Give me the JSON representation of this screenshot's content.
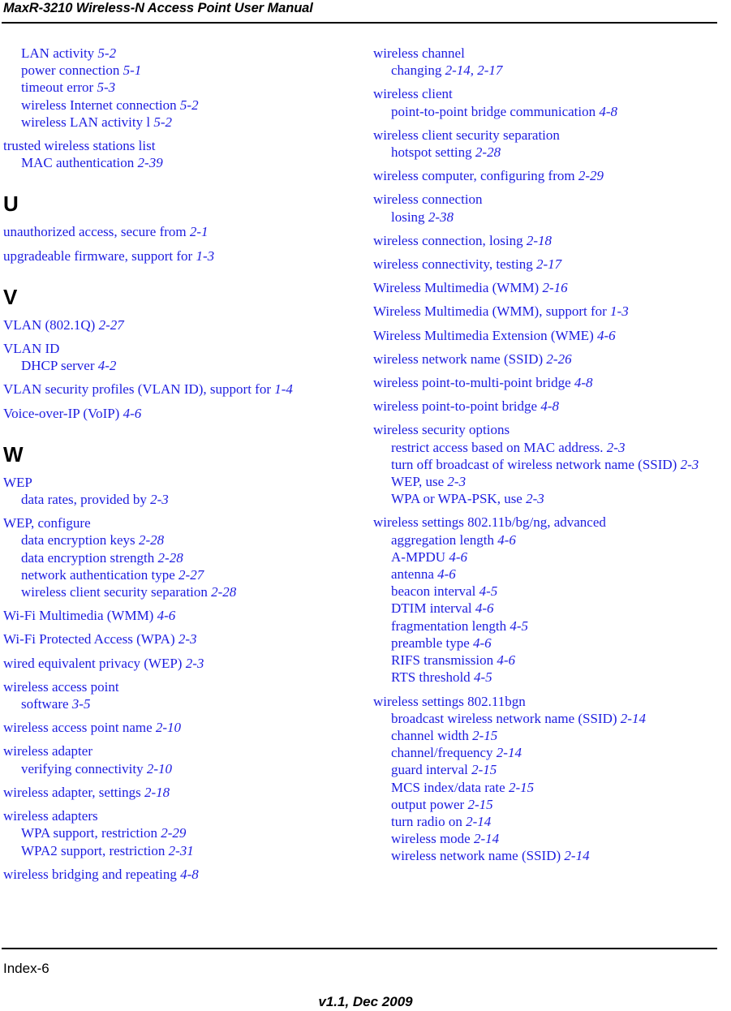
{
  "header": {
    "title": "MaxR-3210 Wireless-N Access Point User Manual"
  },
  "footer": {
    "page_label": "Index-6",
    "version": "v1.1, Dec 2009"
  },
  "colors": {
    "entry_text": "#1D1DE0",
    "heading_text": "#000000",
    "rule": "#000000",
    "background": "#FFFFFF"
  },
  "index": {
    "columns": [
      {
        "id": "left",
        "blocks": [
          {
            "type": "group",
            "entries": [
              {
                "level": 1,
                "text": "LAN activity ",
                "locator": "5-2"
              },
              {
                "level": 1,
                "text": "power connection ",
                "locator": "5-1"
              },
              {
                "level": 1,
                "text": "timeout error ",
                "locator": "5-3"
              },
              {
                "level": 1,
                "text": "wireless Internet connection ",
                "locator": "5-2"
              },
              {
                "level": 1,
                "text": "wireless LAN activity l ",
                "locator": "5-2"
              }
            ]
          },
          {
            "type": "group",
            "entries": [
              {
                "level": 0,
                "text": "trusted wireless stations list",
                "locator": ""
              },
              {
                "level": 1,
                "text": "MAC authentication ",
                "locator": "2-39"
              }
            ]
          },
          {
            "type": "section",
            "letter": "U",
            "gap_before": true,
            "blocks": [
              {
                "type": "group",
                "entries": [
                  {
                    "level": 0,
                    "text": "unauthorized access, secure from ",
                    "locator": "2-1"
                  }
                ]
              },
              {
                "type": "group",
                "entries": [
                  {
                    "level": 0,
                    "text": "upgradeable firmware, support for ",
                    "locator": "1-3"
                  }
                ]
              }
            ]
          },
          {
            "type": "section",
            "letter": "V",
            "gap_before": true,
            "blocks": [
              {
                "type": "group",
                "entries": [
                  {
                    "level": 0,
                    "text": "VLAN (802.1Q) ",
                    "locator": "2-27"
                  }
                ]
              },
              {
                "type": "group",
                "entries": [
                  {
                    "level": 0,
                    "text": "VLAN ID",
                    "locator": ""
                  },
                  {
                    "level": 1,
                    "text": "DHCP server ",
                    "locator": "4-2"
                  }
                ]
              },
              {
                "type": "group",
                "entries": [
                  {
                    "level": 0,
                    "text": "VLAN security profiles (VLAN ID), support for ",
                    "locator": "1-4"
                  }
                ]
              },
              {
                "type": "group",
                "entries": [
                  {
                    "level": 0,
                    "text": "Voice-over-IP (VoIP) ",
                    "locator": "4-6"
                  }
                ]
              }
            ]
          },
          {
            "type": "section",
            "letter": "W",
            "gap_before": true,
            "blocks": [
              {
                "type": "group",
                "entries": [
                  {
                    "level": 0,
                    "text": "WEP",
                    "locator": ""
                  },
                  {
                    "level": 1,
                    "text": "data rates, provided by ",
                    "locator": "2-3"
                  }
                ]
              },
              {
                "type": "group",
                "entries": [
                  {
                    "level": 0,
                    "text": "WEP, configure",
                    "locator": ""
                  },
                  {
                    "level": 1,
                    "text": "data encryption keys ",
                    "locator": "2-28"
                  },
                  {
                    "level": 1,
                    "text": "data encryption strength ",
                    "locator": "2-28"
                  },
                  {
                    "level": 1,
                    "text": "network authentication type ",
                    "locator": "2-27"
                  },
                  {
                    "level": 1,
                    "text": "wireless client security separation ",
                    "locator": "2-28"
                  }
                ]
              },
              {
                "type": "group",
                "entries": [
                  {
                    "level": 0,
                    "text": "Wi-Fi Multimedia (WMM) ",
                    "locator": "4-6"
                  }
                ]
              },
              {
                "type": "group",
                "entries": [
                  {
                    "level": 0,
                    "text": "Wi-Fi Protected Access (WPA) ",
                    "locator": "2-3"
                  }
                ]
              },
              {
                "type": "group",
                "entries": [
                  {
                    "level": 0,
                    "text": "wired equivalent privacy (WEP) ",
                    "locator": "2-3"
                  }
                ]
              },
              {
                "type": "group",
                "entries": [
                  {
                    "level": 0,
                    "text": "wireless access point",
                    "locator": ""
                  },
                  {
                    "level": 1,
                    "text": "software ",
                    "locator": "3-5"
                  }
                ]
              },
              {
                "type": "group",
                "entries": [
                  {
                    "level": 0,
                    "text": "wireless access point name ",
                    "locator": "2-10"
                  }
                ]
              },
              {
                "type": "group",
                "entries": [
                  {
                    "level": 0,
                    "text": "wireless adapter",
                    "locator": ""
                  },
                  {
                    "level": 1,
                    "text": "verifying connectivity ",
                    "locator": "2-10"
                  }
                ]
              },
              {
                "type": "group",
                "entries": [
                  {
                    "level": 0,
                    "text": "wireless adapter, settings ",
                    "locator": "2-18"
                  }
                ]
              },
              {
                "type": "group",
                "entries": [
                  {
                    "level": 0,
                    "text": "wireless adapters",
                    "locator": ""
                  },
                  {
                    "level": 1,
                    "text": "WPA support, restriction ",
                    "locator": "2-29"
                  },
                  {
                    "level": 1,
                    "text": "WPA2 support, restriction ",
                    "locator": "2-31"
                  }
                ]
              },
              {
                "type": "group",
                "entries": [
                  {
                    "level": 0,
                    "text": "wireless bridging and repeating ",
                    "locator": "4-8"
                  }
                ]
              }
            ]
          }
        ]
      },
      {
        "id": "right",
        "blocks": [
          {
            "type": "group",
            "entries": [
              {
                "level": 0,
                "text": "wireless channel",
                "locator": ""
              },
              {
                "level": 1,
                "text": "changing ",
                "locator": "2-14, 2-17"
              }
            ]
          },
          {
            "type": "group",
            "entries": [
              {
                "level": 0,
                "text": "wireless client",
                "locator": ""
              },
              {
                "level": 1,
                "text": "point-to-point bridge communication ",
                "locator": "4-8"
              }
            ]
          },
          {
            "type": "group",
            "entries": [
              {
                "level": 0,
                "text": "wireless client security separation",
                "locator": ""
              },
              {
                "level": 1,
                "text": "hotspot setting ",
                "locator": "2-28"
              }
            ]
          },
          {
            "type": "group",
            "entries": [
              {
                "level": 0,
                "text": "wireless computer, configuring from ",
                "locator": "2-29"
              }
            ]
          },
          {
            "type": "group",
            "entries": [
              {
                "level": 0,
                "text": "wireless connection",
                "locator": ""
              },
              {
                "level": 1,
                "text": "losing ",
                "locator": "2-38"
              }
            ]
          },
          {
            "type": "group",
            "entries": [
              {
                "level": 0,
                "text": "wireless connection, losing ",
                "locator": "2-18"
              }
            ]
          },
          {
            "type": "group",
            "entries": [
              {
                "level": 0,
                "text": "wireless connectivity, testing ",
                "locator": "2-17"
              }
            ]
          },
          {
            "type": "group",
            "entries": [
              {
                "level": 0,
                "text": "Wireless Multimedia (WMM) ",
                "locator": "2-16"
              }
            ]
          },
          {
            "type": "group",
            "entries": [
              {
                "level": 0,
                "text": "Wireless Multimedia (WMM), support for ",
                "locator": "1-3"
              }
            ]
          },
          {
            "type": "group",
            "entries": [
              {
                "level": 0,
                "text": "Wireless Multimedia Extension (WME) ",
                "locator": "4-6"
              }
            ]
          },
          {
            "type": "group",
            "entries": [
              {
                "level": 0,
                "text": "wireless network name (SSID) ",
                "locator": "2-26"
              }
            ]
          },
          {
            "type": "group",
            "entries": [
              {
                "level": 0,
                "text": "wireless point-to-multi-point bridge ",
                "locator": "4-8"
              }
            ]
          },
          {
            "type": "group",
            "entries": [
              {
                "level": 0,
                "text": "wireless point-to-point bridge ",
                "locator": "4-8"
              }
            ]
          },
          {
            "type": "group",
            "entries": [
              {
                "level": 0,
                "text": "wireless security options",
                "locator": ""
              },
              {
                "level": 1,
                "text": "restrict access based on MAC address. ",
                "locator": "2-3"
              },
              {
                "level": 1,
                "text": "turn off broadcast of wireless network name (SSID) ",
                "locator": "2-3"
              },
              {
                "level": 1,
                "text": "WEP, use ",
                "locator": "2-3"
              },
              {
                "level": 1,
                "text": "WPA or WPA-PSK, use ",
                "locator": "2-3"
              }
            ]
          },
          {
            "type": "group",
            "entries": [
              {
                "level": 0,
                "text": "wireless settings 802.11b/bg/ng, advanced",
                "locator": ""
              },
              {
                "level": 1,
                "text": "aggregation length ",
                "locator": "4-6"
              },
              {
                "level": 1,
                "text": "A-MPDU ",
                "locator": "4-6"
              },
              {
                "level": 1,
                "text": "antenna ",
                "locator": "4-6"
              },
              {
                "level": 1,
                "text": "beacon interval ",
                "locator": "4-5"
              },
              {
                "level": 1,
                "text": "DTIM interval ",
                "locator": "4-6"
              },
              {
                "level": 1,
                "text": "fragmentation length ",
                "locator": "4-5"
              },
              {
                "level": 1,
                "text": "preamble type ",
                "locator": "4-6"
              },
              {
                "level": 1,
                "text": "RIFS transmission ",
                "locator": "4-6"
              },
              {
                "level": 1,
                "text": "RTS threshold ",
                "locator": "4-5"
              }
            ]
          },
          {
            "type": "group",
            "entries": [
              {
                "level": 0,
                "text": "wireless settings 802.11bgn",
                "locator": ""
              },
              {
                "level": 1,
                "text": "broadcast wireless network name (SSID) ",
                "locator": "2-14"
              },
              {
                "level": 1,
                "text": "channel width ",
                "locator": "2-15"
              },
              {
                "level": 1,
                "text": "channel/frequency ",
                "locator": "2-14"
              },
              {
                "level": 1,
                "text": "guard interval ",
                "locator": "2-15"
              },
              {
                "level": 1,
                "text": "MCS index/data rate ",
                "locator": "2-15"
              },
              {
                "level": 1,
                "text": "output power ",
                "locator": "2-15"
              },
              {
                "level": 1,
                "text": "turn radio on ",
                "locator": "2-14"
              },
              {
                "level": 1,
                "text": "wireless mode ",
                "locator": "2-14"
              },
              {
                "level": 1,
                "text": "wireless network name (SSID) ",
                "locator": "2-14"
              }
            ]
          }
        ]
      }
    ]
  }
}
